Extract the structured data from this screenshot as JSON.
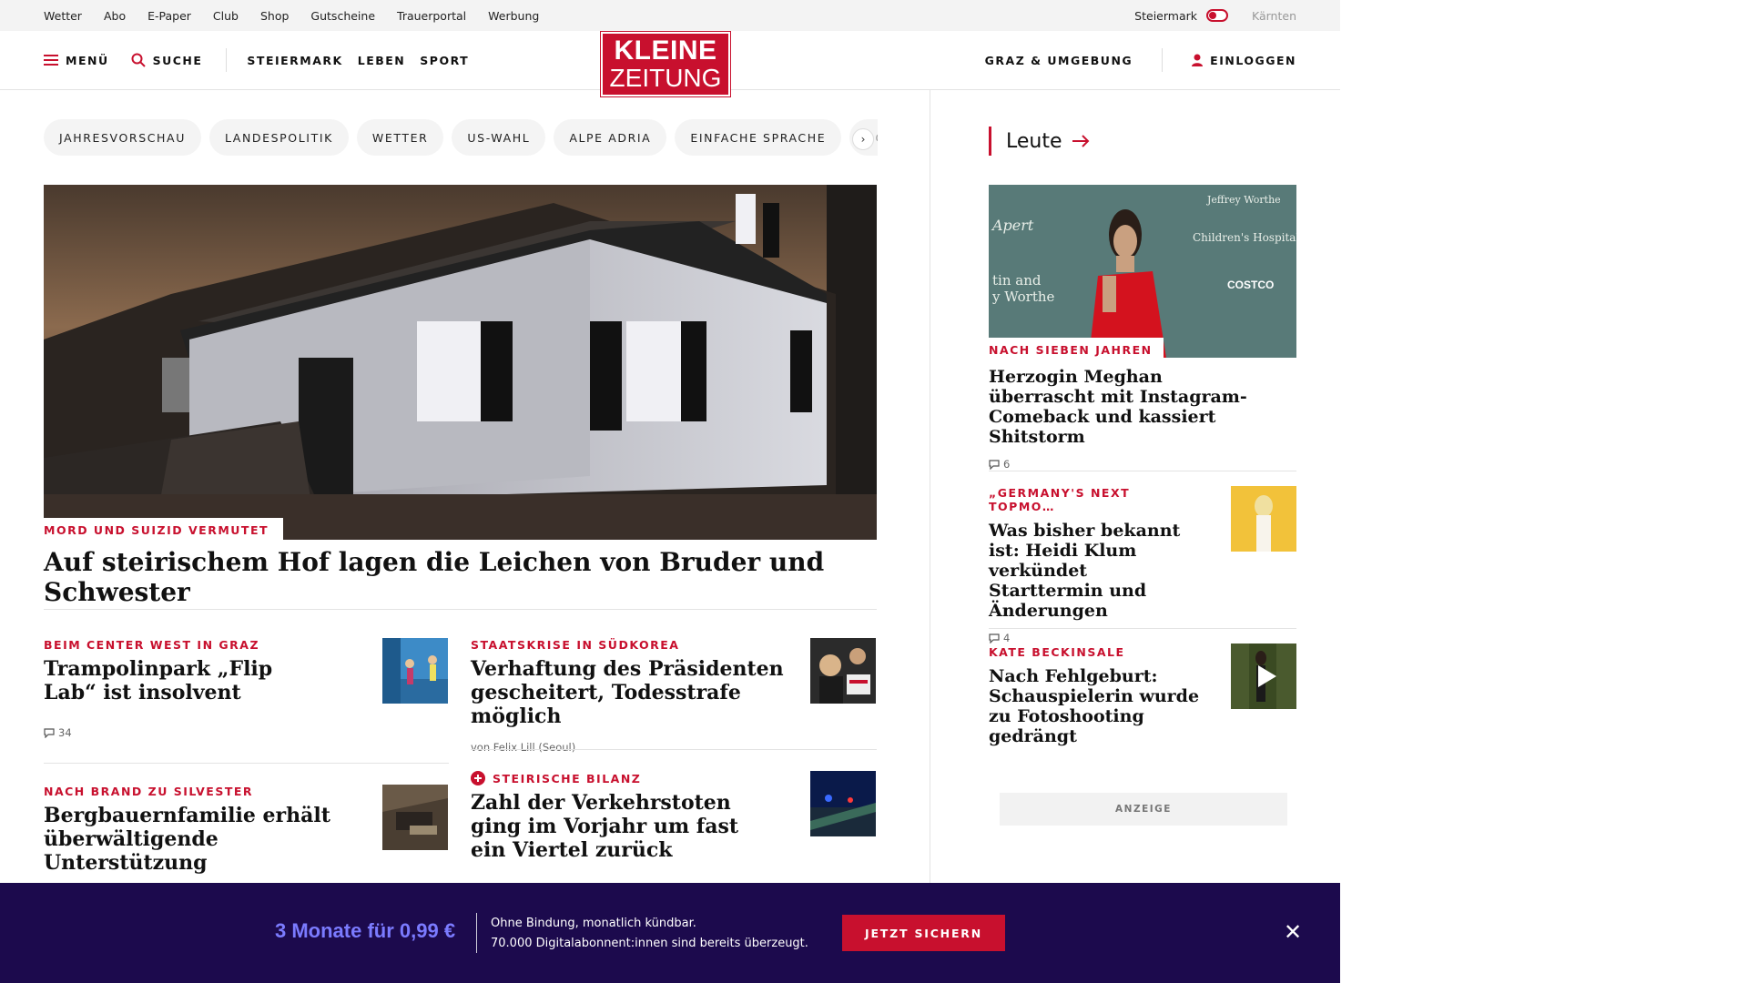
{
  "util_links": [
    "Wetter",
    "Abo",
    "E-Paper",
    "Club",
    "Shop",
    "Gutscheine",
    "Trauerportal",
    "Werbung"
  ],
  "region": {
    "active": "Steiermark",
    "inactive": "Kärnten"
  },
  "header": {
    "menu_label": "MENÜ",
    "search_label": "SUCHE",
    "nav": [
      "STEIERMARK",
      "LEBEN",
      "SPORT"
    ],
    "logo_line1": "KLEINE",
    "logo_line2": "ZEITUNG",
    "local_label": "GRAZ & UMGEBUNG",
    "login_label": "EINLOGGEN"
  },
  "chips": [
    "JAHRESVORSCHAU",
    "LANDESPOLITIK",
    "WETTER",
    "US-WAHL",
    "ALPE ADRIA",
    "EINFACHE SPRACHE",
    "DOS"
  ],
  "hero": {
    "kicker": "MORD UND SUIZID VERMUTET",
    "title": "Auf steirischem Hof lagen die Leichen von Bruder und Schwester"
  },
  "teasers": [
    {
      "kicker": "BEIM CENTER WEST IN GRAZ",
      "title": "Trampolinpark „Flip Lab“ ist insolvent",
      "comments": "34"
    },
    {
      "kicker": "STAATSKRISE IN SÜDKOREA",
      "title": "Verhaftung des Präsidenten gescheitert, Todesstrafe möglich",
      "author": "von Felix Lill (Seoul)"
    },
    {
      "kicker": "NACH BRAND ZU SILVESTER",
      "title": "Bergbauernfamilie erhält überwältigende Unterstützung"
    },
    {
      "kicker": "STEIRISCHE BILANZ",
      "title": "Zahl der Verkehrstoten ging im Vorjahr um fast ein Viertel zurück"
    }
  ],
  "side": {
    "heading": "Leute",
    "items": [
      {
        "kicker": "NACH SIEBEN JAHREN",
        "title": "Herzogin Meghan überrascht mit Instagram-Comeback und kassiert Shitstorm",
        "comments": "6"
      },
      {
        "kicker": "„GERMANY'S NEXT TOPMO…",
        "title": "Was bisher bekannt ist: Heidi Klum verkündet Starttermin und Änderungen",
        "comments": "4"
      },
      {
        "kicker": "KATE BECKINSALE",
        "title": "Nach Fehlgeburt: Schauspielerin wurde zu Fotoshooting gedrängt"
      }
    ],
    "ad_label": "ANZEIGE"
  },
  "banner": {
    "price": "3 Monate für 0,99 €",
    "line1": "Ohne Bindung, monatlich kündbar.",
    "line2": "70.000 Digitalabonnent:innen sind bereits überzeugt.",
    "cta": "JETZT SICHERN"
  },
  "colors": {
    "brand_red": "#c8102e",
    "banner_bg": "#1c0a4d",
    "price_color": "#7b7bff"
  }
}
